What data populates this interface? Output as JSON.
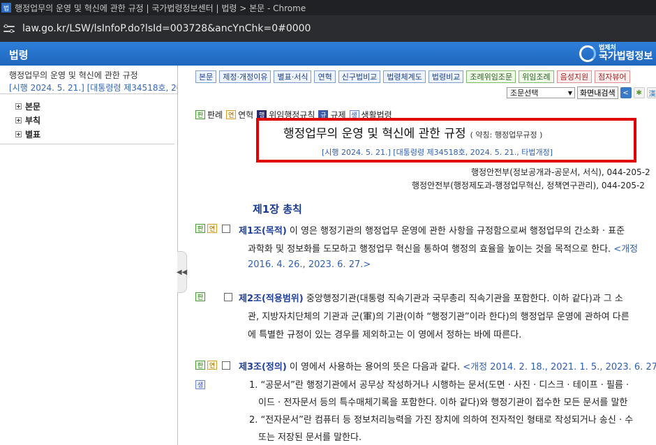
{
  "browser": {
    "favicon": "법",
    "window_title": "행정업무의 운영 및 혁신에 관한 규정 | 국가법령정보센터 | 법령 > 본문 - Chrome",
    "url": "law.go.kr/LSW/lsInfoP.do?lsId=003728&ancYnChk=0#0000"
  },
  "header": {
    "brand": "법령",
    "logo_sub": "법제처",
    "logo_main": "국가법령정보"
  },
  "sidebar": {
    "title": "행정업무의 운영 및 혁신에 관한 규정",
    "subtitle": "[시행 2024. 5. 21.] [대통령령 제34518호, 20",
    "items": [
      "본문",
      "부칙",
      "별표"
    ]
  },
  "toolbar": {
    "tabs": [
      "본문",
      "제정·개정이유",
      "별표·서식",
      "연혁",
      "신구법비교",
      "법령체계도",
      "법령비교",
      "조례위임조문",
      "위임조례",
      "음성지원",
      "점자뷰어"
    ],
    "select_value": "조문선택",
    "search_button": "화면내검색"
  },
  "legend": {
    "items": [
      {
        "mark": "판",
        "label": "판례"
      },
      {
        "mark": "연",
        "label": "연혁"
      },
      {
        "mark": "행",
        "label": "위임행정규칙"
      },
      {
        "mark": "규",
        "label": "규제"
      },
      {
        "mark": "생",
        "label": "생활법령"
      }
    ]
  },
  "law": {
    "title": "행정업무의 운영 및 혁신에 관한 규정",
    "abbr": "( 약칭: 행정업무규정 )",
    "date": "[시행 2024. 5. 21.] [대통령령 제34518호, 2024. 5. 21., 타법개정]",
    "dept1": "행정안전부(정보공개과-공문서, 서식), 044-205-2",
    "dept2": "행정안전부(행정제도과-행정업무혁신, 정책연구관리), 044-205-2"
  },
  "chapter": "제1장 총칙",
  "articles": {
    "a1": {
      "heading": "제1조(목적)",
      "l1": " 이 영은 행정기관의 행정업무 운영에 관한 사항을 규정함으로써 행정업무의 간소화 · 표준",
      "l2": "과학화 및 정보화를 도모하고 행정업무 혁신을 통하여 행정의 효율을 높이는 것을 목적으로 한다. ",
      "l2b": "<개정",
      "l3": "2016. 4. 26., 2023. 6. 27.>"
    },
    "a2": {
      "heading": "제2조(적용범위)",
      "l1": " 중앙행정기관(대통령 직속기관과 국무총리 직속기관을 포함한다. 이하 같다)과 그 소",
      "l2": "관, 지방자치단체의 기관과 군(軍)의 기관(이하 “행정기관”이라 한다)의 행정업무 운영에 관하여 다른",
      "l3": "에 특별한 규정이 있는 경우를 제외하고는 이 영에서 정하는 바에 따른다."
    },
    "a3": {
      "heading": "제3조(정의)",
      "l1": " 이 영에서 사용하는 용어의 뜻은 다음과 같다. ",
      "l1b": "<개정 2014. 2. 18., 2021. 1. 5., 2023. 6. 27.",
      "i1a": "1. “공문서”란 행정기관에서 공무상 작성하거나 시행하는 문서(도면 · 사진 · 디스크 · 테이프 · 필름 · ",
      "i1b": "이드 · 전자문서 등의 특수매체기록을 포함한다. 이하 같다)와 행정기관이 접수한 모든 문서를 말한",
      "i2a": "2. “전자문서”란 컴퓨터 등 정보처리능력을 가진 장치에 의하여 전자적인 형태로 작성되거나 송신 · 수",
      "i2b": "또는 저장된 문서를 말한다."
    }
  },
  "colors": {
    "header": "#2d7fd8",
    "highlight_box": "#e00000",
    "link": "#2f5fb0"
  }
}
